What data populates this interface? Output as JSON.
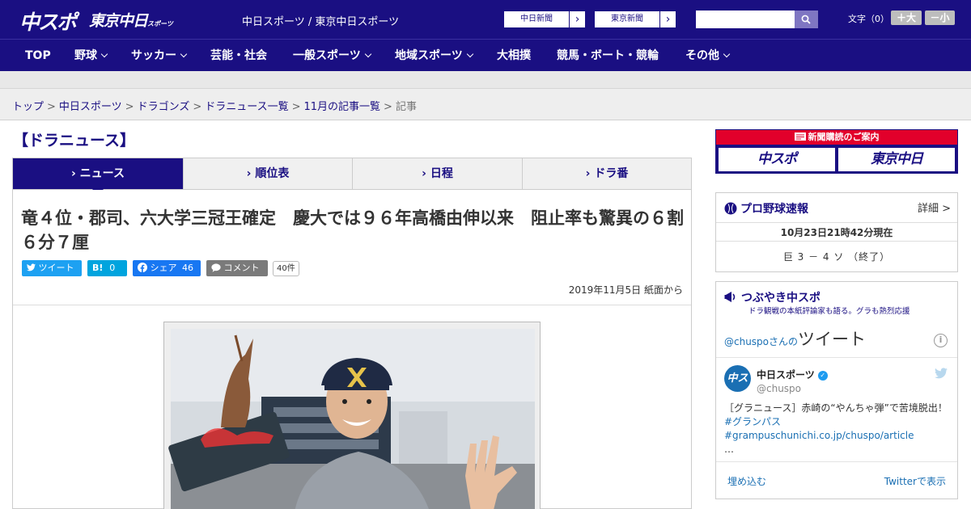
{
  "header": {
    "logo_chuspo": "中スポ",
    "logo_tokyo": "東京中日",
    "logo_tokyo_small": "スポーツ",
    "site_links": "中日スポーツ / 東京中日スポーツ",
    "paper_btn_1": "中日新聞",
    "paper_btn_2": "東京新聞",
    "fontsize_label": "文字（0）",
    "fontsize_plus": "＋大",
    "fontsize_minus": "－小",
    "search_placeholder": ""
  },
  "nav": [
    "TOP",
    "野球",
    "サッカー",
    "芸能・社会",
    "一般スポーツ",
    "地域スポーツ",
    "大相撲",
    "競馬・ボート・競輪",
    "その他"
  ],
  "breadcrumb": [
    "トップ",
    "中日スポーツ",
    "ドラゴンズ",
    "ドラニュース一覧",
    "11月の記事一覧",
    "記事"
  ],
  "section_title": "【ドラニュース】",
  "tabs": [
    "ニュース",
    "順位表",
    "日程",
    "ドラ番"
  ],
  "article": {
    "headline": "竜４位・郡司、六大学三冠王確定　慶大では９６年高橋由伸以来　阻止率も驚異の６割６分７厘",
    "share": {
      "tweet": "ツイート",
      "hatena": "B!",
      "hatena_count": "0",
      "facebook": "シェア",
      "facebook_count": "46",
      "comment": "コメント",
      "comment_count": "40件"
    },
    "dateline": "2019年11月5日 紙面から"
  },
  "sidebar": {
    "subscription_header": "新聞購読のご案内",
    "sub_btn_1": "中スポ",
    "sub_btn_2": "東京中日",
    "score_title": "プロ野球速報",
    "score_detail": "詳細 >",
    "score_date": "10月23日21時42分現在",
    "score_line": "巨 3 － 4 ソ （終了）",
    "tw_title": "つぶやき中スポ",
    "tw_sub": "ドラ観戦の本紙評論家も語る。グラも熱烈応援",
    "tw_head_prefix": "@chuspoさんの",
    "tw_head_big": "ツイート",
    "tw_avatar": "中スポ",
    "tw_name": "中日スポーツ",
    "tw_handle": "@chuspo",
    "tw_text_1": "［グラニュース］赤崎の“やんちゃ弾”で苦境脱出！",
    "tw_text_2": "#グランパス #grampuschunichi.co.jp/chuspo/article",
    "tw_text_3": "…",
    "tw_embed": "埋め込む",
    "tw_view": "Twitterで表示"
  },
  "colors": {
    "brand_navy": "#1a0f82",
    "twitter_blue": "#1da1f2",
    "hatena_blue": "#00a4de",
    "facebook_blue": "#1877f2",
    "subscription_red": "#e2002b"
  }
}
